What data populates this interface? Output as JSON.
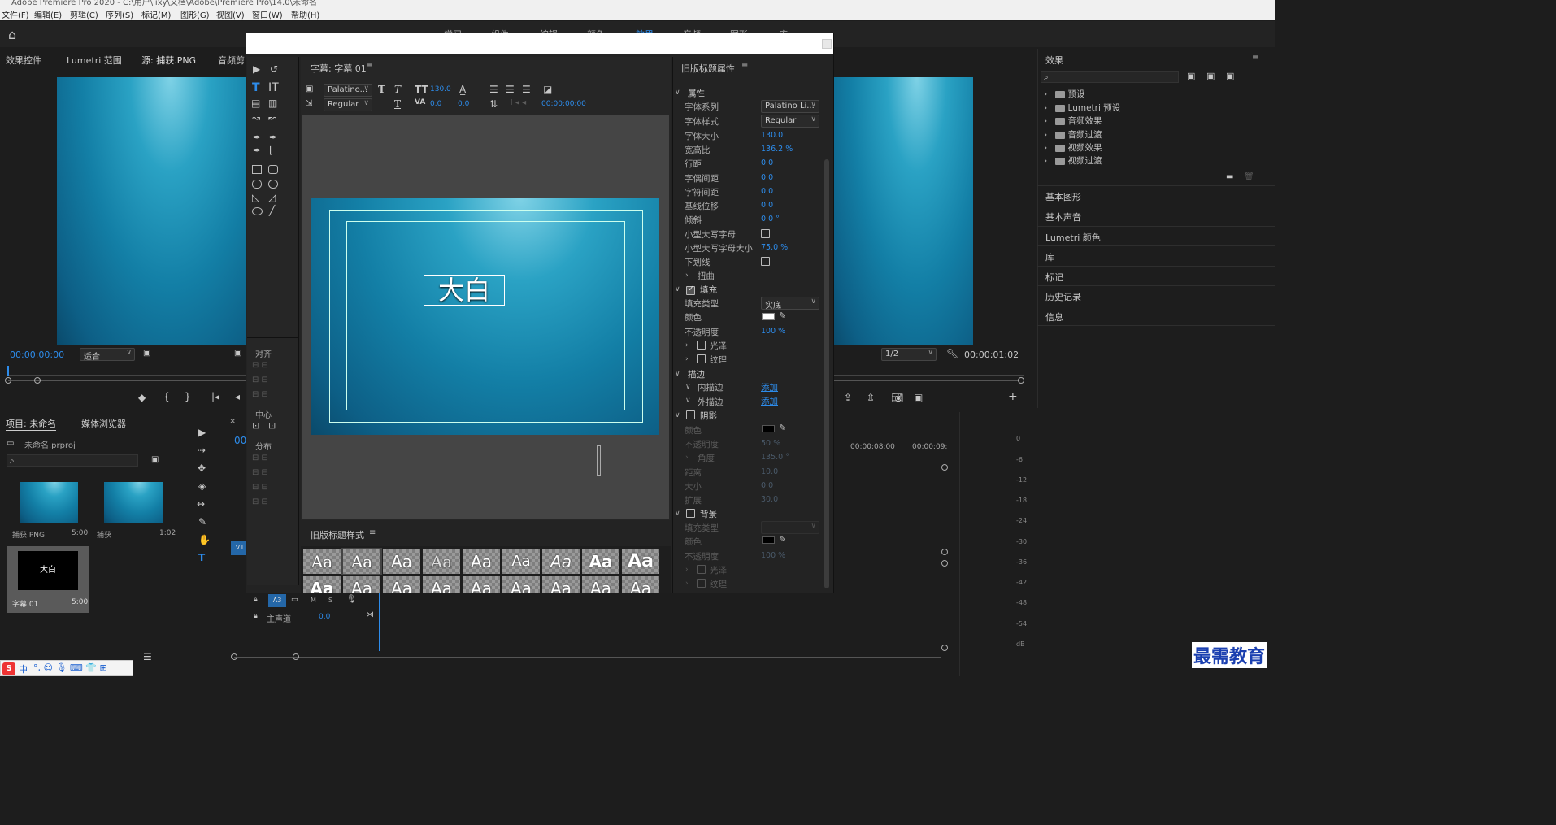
{
  "titlebar": {
    "text": "Adobe Premiere Pro 2020 - C:\\用户\\lixy\\文档\\Adobe\\Premiere Pro\\14.0\\未命名"
  },
  "menu": [
    "文件(F)",
    "编辑(E)",
    "剪辑(C)",
    "序列(S)",
    "标记(M)",
    "图形(G)",
    "视图(V)",
    "窗口(W)",
    "帮助(H)"
  ],
  "workspaces": [
    "学习",
    "组件",
    "编辑",
    "颜色",
    "效果",
    "音频",
    "图形",
    "库"
  ],
  "source_tabs": [
    "效果控件",
    "Lumetri 范围",
    "源: 捕获.PNG",
    "音频剪"
  ],
  "source": {
    "timecode": "00:00:00:00",
    "fit": "适合"
  },
  "program": {
    "zoom": "1/2",
    "timecode": "00:00:01:02"
  },
  "project": {
    "tabs": [
      "项目: 未命名",
      "媒体浏览器"
    ],
    "file": "未命名.prproj",
    "items": [
      {
        "name": "捕获.PNG",
        "dur": "5:00"
      },
      {
        "name": "捕获",
        "dur": "1:02"
      },
      {
        "name": "字幕 01",
        "dur": "5:00",
        "thumb_text": "大白"
      }
    ]
  },
  "timeline": {
    "track_a3": "A3",
    "track_m": "M",
    "track_s": "S",
    "master": "主声道",
    "master_val": "0.0",
    "t1": "00:00:08:00",
    "t2": "00:00:09:",
    "v1": "V1"
  },
  "titler": {
    "tab": "字幕: 字幕 01",
    "font": "Palatino...",
    "style": "Regular",
    "size": "130.0",
    "kerning": "0.0",
    "leading": "0.0",
    "timecode": "00:00:00:00",
    "canvas_text": "大白",
    "align_label": "对齐",
    "center_label": "中心",
    "distribute_label": "分布",
    "styles_tab": "旧版标题样式",
    "style_sample": "Aa"
  },
  "props": {
    "title": "旧版标题属性",
    "rows": [
      {
        "k": "属性",
        "type": "section"
      },
      {
        "k": "字体系列",
        "v": "Palatino Li..."
      },
      {
        "k": "字体样式",
        "v": "Regular"
      },
      {
        "k": "字体大小",
        "v": "130.0"
      },
      {
        "k": "宽高比",
        "v": "136.2 %"
      },
      {
        "k": "行距",
        "v": "0.0"
      },
      {
        "k": "字偶间距",
        "v": "0.0"
      },
      {
        "k": "字符间距",
        "v": "0.0"
      },
      {
        "k": "基线位移",
        "v": "0.0"
      },
      {
        "k": "倾斜",
        "v": "0.0 °"
      },
      {
        "k": "小型大写字母",
        "v": ""
      },
      {
        "k": "小型大写字母大小",
        "v": "75.0 %"
      },
      {
        "k": "下划线",
        "v": ""
      },
      {
        "k": "扭曲",
        "v": ""
      },
      {
        "k": "填充",
        "type": "section"
      },
      {
        "k": "填充类型",
        "v": "实底"
      },
      {
        "k": "颜色",
        "v": ""
      },
      {
        "k": "不透明度",
        "v": "100 %"
      },
      {
        "k": "光泽",
        "v": ""
      },
      {
        "k": "纹理",
        "v": ""
      },
      {
        "k": "描边",
        "type": "section"
      },
      {
        "k": "内描边",
        "v": "添加"
      },
      {
        "k": "外描边",
        "v": "添加"
      },
      {
        "k": "阴影",
        "type": "section"
      },
      {
        "k": "颜色",
        "v": ""
      },
      {
        "k": "不透明度",
        "v": "50 %"
      },
      {
        "k": "角度",
        "v": "135.0 °"
      },
      {
        "k": "距离",
        "v": "10.0"
      },
      {
        "k": "大小",
        "v": "0.0"
      },
      {
        "k": "扩展",
        "v": "30.0"
      },
      {
        "k": "背景",
        "type": "section"
      },
      {
        "k": "填充类型",
        "v": ""
      },
      {
        "k": "颜色",
        "v": ""
      },
      {
        "k": "不透明度",
        "v": "100 %"
      },
      {
        "k": "光泽",
        "v": ""
      },
      {
        "k": "纹理",
        "v": ""
      }
    ]
  },
  "effects": {
    "title": "效果",
    "tree": [
      "预设",
      "Lumetri 预设",
      "音频效果",
      "音频过渡",
      "视频效果",
      "视频过渡"
    ],
    "panels": [
      "基本图形",
      "基本声音",
      "Lumetri 颜色",
      "库",
      "标记",
      "历史记录",
      "信息"
    ]
  },
  "meter": [
    "0",
    "-6",
    "-12",
    "-18",
    "-24",
    "-30",
    "-36",
    "-42",
    "-48",
    "-54",
    "dB"
  ],
  "watermark": "最需教育",
  "ime": "中"
}
